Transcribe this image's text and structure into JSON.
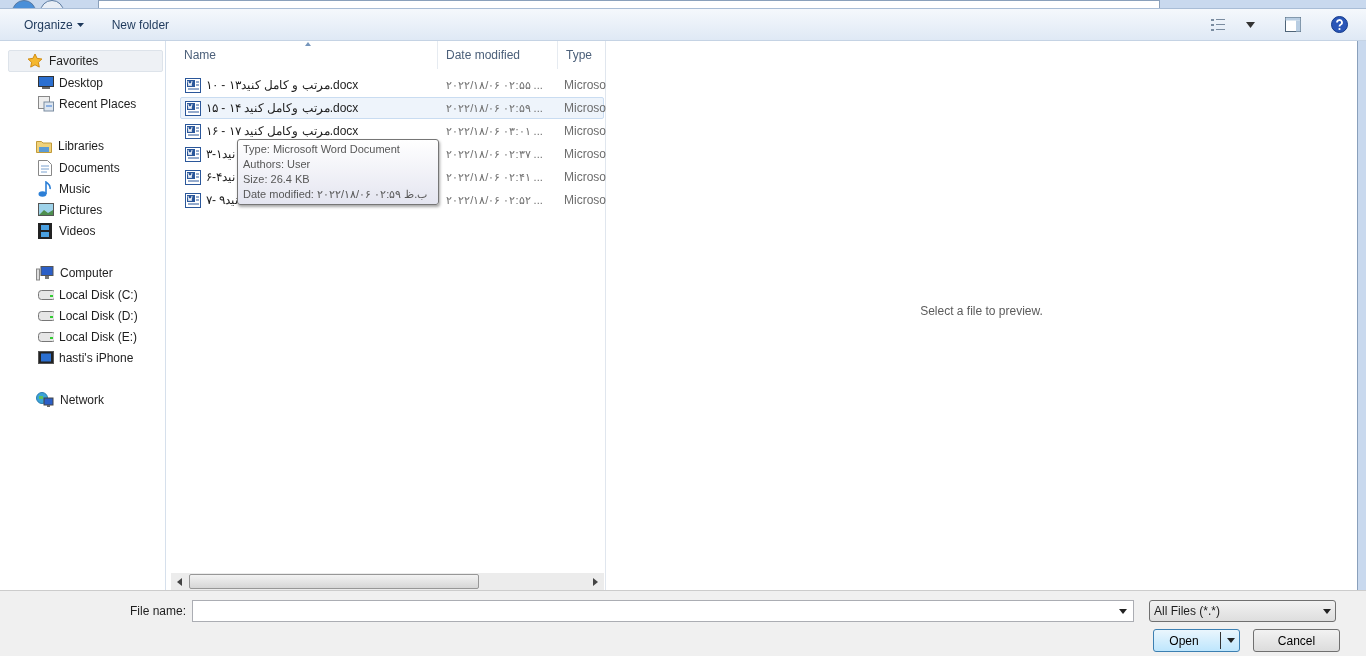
{
  "toolbar": {
    "organize": "Organize",
    "new_folder": "New folder"
  },
  "sidebar": {
    "groups": [
      {
        "label": "Favorites",
        "selected": true,
        "items": [
          {
            "label": "Desktop"
          },
          {
            "label": "Recent Places"
          }
        ]
      },
      {
        "label": "Libraries",
        "selected": false,
        "items": [
          {
            "label": "Documents"
          },
          {
            "label": "Music"
          },
          {
            "label": "Pictures"
          },
          {
            "label": "Videos"
          }
        ]
      },
      {
        "label": "Computer",
        "selected": false,
        "items": [
          {
            "label": "Local Disk (C:)"
          },
          {
            "label": "Local Disk (D:)"
          },
          {
            "label": "Local Disk (E:)"
          },
          {
            "label": "hasti's iPhone"
          }
        ]
      },
      {
        "label": "Network",
        "selected": false
      }
    ]
  },
  "table": {
    "columns": [
      "Name",
      "Date modified",
      "Type"
    ],
    "rows": [
      {
        "name": "مرتب و کامل کنید۱۳ - ۱۰.docx",
        "date": "۲۰۲۲/۱۸/۰۶ ۰۲:۵۵ ...",
        "type": "Microso",
        "hovered": false
      },
      {
        "name": "مرتب وکامل کنید ۱۴ - ۱۵.docx",
        "date": "۲۰۲۲/۱۸/۰۶ ۰۲:۵۹ ...",
        "type": "Microso",
        "hovered": true
      },
      {
        "name": "مرتب وکامل کنید ۱۷ - ۱۶.docx",
        "date": "۲۰۲۲/۱۸/۰۶ ۰۳:۰۱ ...",
        "type": "Microso",
        "hovered": false
      },
      {
        "name": "نید۱-۳",
        "date": "۲۰۲۲/۱۸/۰۶ ۰۲:۳۷ ...",
        "type": "Microso",
        "hovered": false
      },
      {
        "name": "نید۴-۶",
        "date": "۲۰۲۲/۱۸/۰۶ ۰۲:۴۱ ...",
        "type": "Microso",
        "hovered": false
      },
      {
        "name": "نید۹ -۷",
        "date": "۲۰۲۲/۱۸/۰۶ ۰۲:۵۲ ...",
        "type": "Microso",
        "hovered": false
      }
    ]
  },
  "tooltip": [
    "Type: Microsoft Word Document",
    "Authors: User",
    "Size: 26.4 KB",
    "Date modified: ۲۰۲۲/۱۸/۰۶ ب.ظ ۰۲:۵۹"
  ],
  "preview": {
    "message": "Select a file to preview."
  },
  "footer": {
    "file_name_label": "File name:",
    "filter": "All Files (*.*)",
    "open": "Open",
    "cancel": "Cancel"
  }
}
